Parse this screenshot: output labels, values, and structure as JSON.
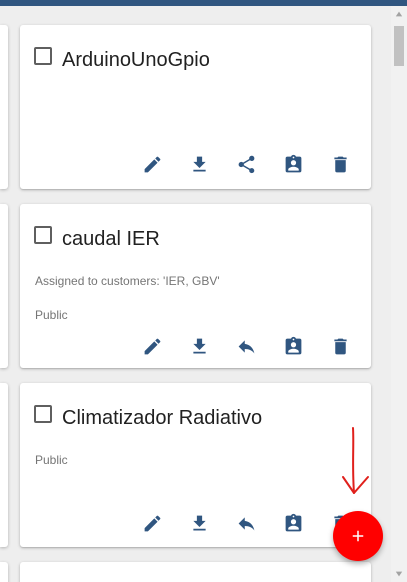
{
  "colors": {
    "accent": "#305680",
    "fab": "#ff0000",
    "annotation": "#e0201c"
  },
  "cards": [
    {
      "title": "ArduinoUnoGpio",
      "assigned": "",
      "visibility": "",
      "actions": [
        "edit-icon",
        "download-icon",
        "share-icon",
        "assign-to-customer-icon",
        "delete-icon"
      ]
    },
    {
      "title": "caudal IER",
      "assigned": "Assigned to customers: 'IER, GBV'",
      "visibility": "Public",
      "actions": [
        "edit-icon",
        "download-icon",
        "reply-icon",
        "assign-to-customer-icon",
        "delete-icon"
      ]
    },
    {
      "title": "Climatizador Radiativo",
      "assigned": "",
      "visibility": "Public",
      "actions": [
        "edit-icon",
        "download-icon",
        "reply-icon",
        "assign-to-customer-icon",
        "delete-icon"
      ]
    }
  ],
  "fab": {
    "icon": "plus-icon"
  },
  "annotation": {
    "icon": "red-arrow-down-icon"
  }
}
